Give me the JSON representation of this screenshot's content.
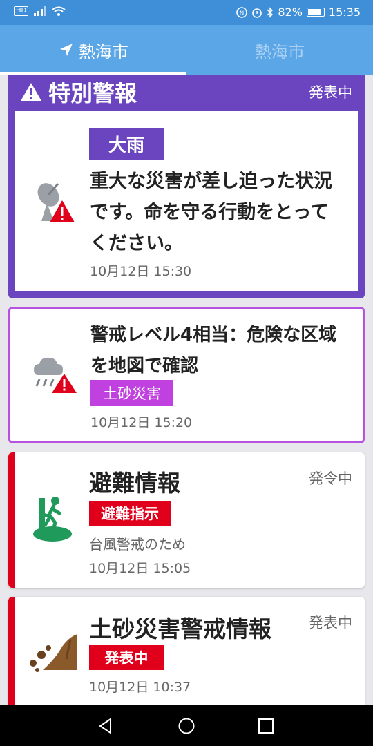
{
  "statusbar": {
    "battery_percent": "82%",
    "time": "15:35",
    "hd_label": "HD"
  },
  "tabs": [
    {
      "label": "熱海市",
      "active": true,
      "icon": "location-arrow-icon"
    },
    {
      "label": "熱海市",
      "active": false
    }
  ],
  "special_warning": {
    "title": "特別警報",
    "status": "発表中",
    "tag": "大雨",
    "message_line1": "重大な災害が差し迫った状況",
    "message_line2": "です。命を守る行動をとって",
    "message_line3": "ください。",
    "time": "10月12日 15:30",
    "icon": "radar-warning-icon",
    "color": "#6a45bf"
  },
  "level_card": {
    "line1": "警戒レベル4相当：危険な区域",
    "line2": "を地図で確認",
    "tag": "土砂災害",
    "time": "10月12日 15:20",
    "icon": "rain-cloud-warning-icon",
    "color": "#b651e0"
  },
  "evacuation_card": {
    "title": "避難情報",
    "status": "発令中",
    "tag": "避難指示",
    "sub": "台風警戒のため",
    "time": "10月12日 15:05",
    "icon": "evacuation-runner-icon",
    "color": "#e0001c"
  },
  "landslide_card": {
    "title": "土砂災害警戒情報",
    "status": "発表中",
    "tag": "発表中",
    "time": "10月12日 10:37",
    "icon": "landslide-icon"
  }
}
